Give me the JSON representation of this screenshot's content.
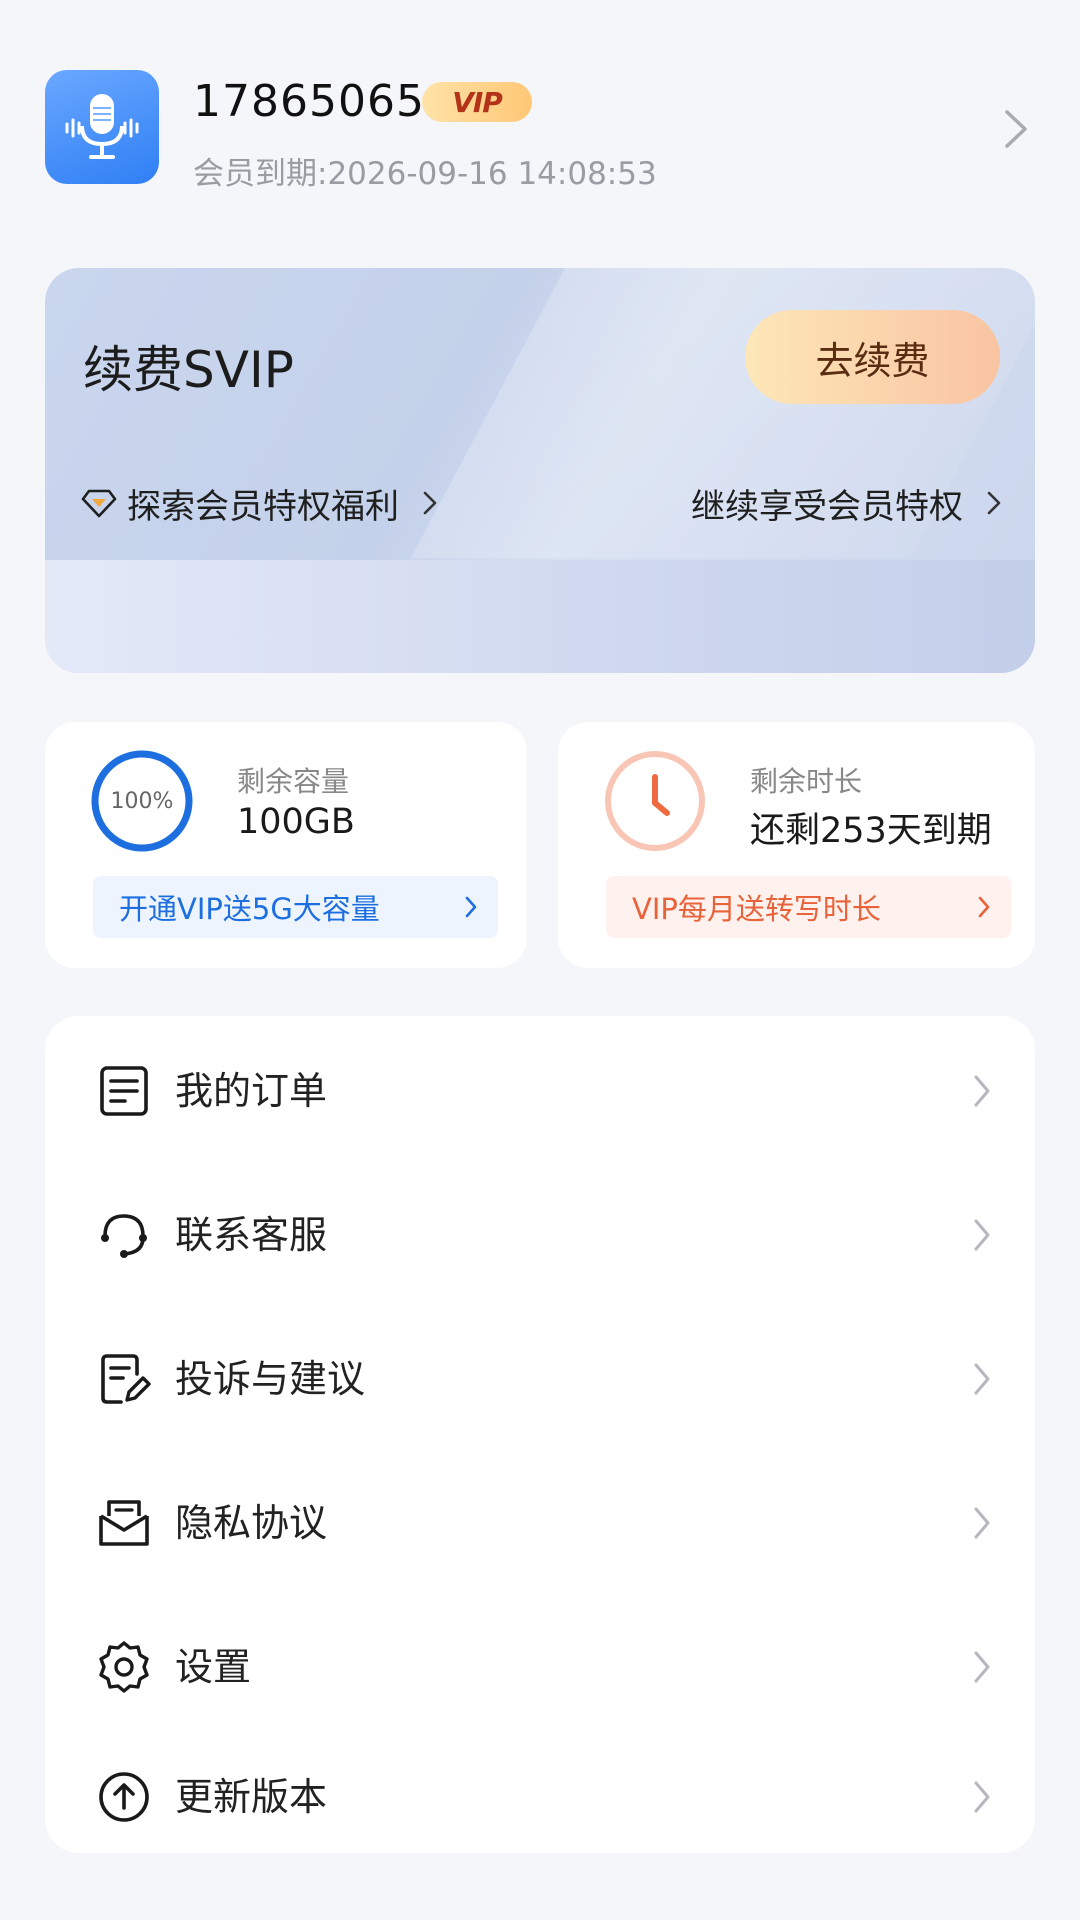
{
  "profile": {
    "user_id": "17865065",
    "vip_badge": "VIP",
    "expire_text": "会员到期:2026-09-16 14:08:53"
  },
  "renew": {
    "title": "续费SVIP",
    "button": "去续费",
    "explore_link": "探索会员特权福利",
    "continue_link": "继续享受会员特权"
  },
  "storage": {
    "ring_label": "100%",
    "ring_fraction": 1.0,
    "label": "剩余容量",
    "value": "100GB",
    "promo": "开通VIP送5G大容量"
  },
  "duration": {
    "label": "剩余时长",
    "value": "还剩253天到期",
    "promo": "VIP每月送转写时长"
  },
  "menu": {
    "items": [
      {
        "label": "我的订单",
        "icon": "order-icon"
      },
      {
        "label": "联系客服",
        "icon": "headset-icon"
      },
      {
        "label": "投诉与建议",
        "icon": "feedback-icon"
      },
      {
        "label": "隐私协议",
        "icon": "privacy-icon"
      },
      {
        "label": "设置",
        "icon": "gear-icon"
      },
      {
        "label": "更新版本",
        "icon": "upgrade-icon"
      }
    ]
  },
  "colors": {
    "accent_blue": "#1d6fe0",
    "accent_orange": "#e8623a",
    "app_icon": "#2f7ff5"
  }
}
